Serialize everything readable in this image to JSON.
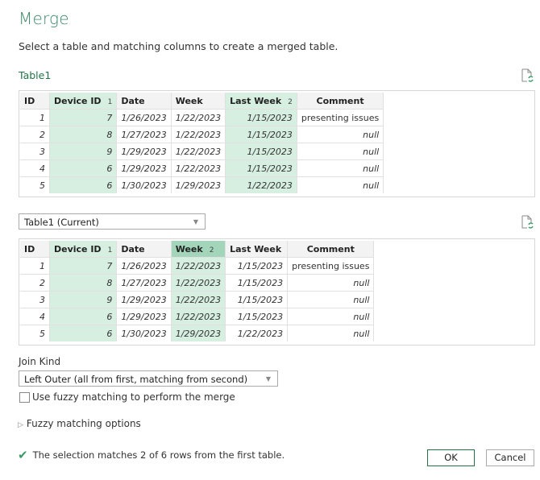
{
  "dialog": {
    "title": "Merge",
    "subtitle": "Select a table and matching columns to create a merged table."
  },
  "table1": {
    "label": "Table1",
    "refresh_icon": "refresh-preview-icon",
    "columns": [
      {
        "name": "ID",
        "selected": false,
        "order": ""
      },
      {
        "name": "Device ID",
        "selected": true,
        "order": "1"
      },
      {
        "name": "Date",
        "selected": false,
        "order": ""
      },
      {
        "name": "Week",
        "selected": false,
        "order": ""
      },
      {
        "name": "Last Week",
        "selected": true,
        "order": "2"
      },
      {
        "name": "Comment",
        "selected": false,
        "order": ""
      }
    ],
    "rows": [
      [
        "1",
        "7",
        "1/26/2023",
        "1/22/2023",
        "1/15/2023",
        "presenting issues"
      ],
      [
        "2",
        "8",
        "1/27/2023",
        "1/22/2023",
        "1/15/2023",
        "null"
      ],
      [
        "3",
        "9",
        "1/29/2023",
        "1/22/2023",
        "1/15/2023",
        "null"
      ],
      [
        "4",
        "6",
        "1/29/2023",
        "1/22/2023",
        "1/15/2023",
        "null"
      ],
      [
        "5",
        "6",
        "1/30/2023",
        "1/29/2023",
        "1/22/2023",
        "null"
      ]
    ]
  },
  "table2": {
    "selected_table": "Table1 (Current)",
    "refresh_icon": "refresh-preview-icon",
    "columns": [
      {
        "name": "ID",
        "selected": false,
        "order": ""
      },
      {
        "name": "Device ID",
        "selected": true,
        "order": "1"
      },
      {
        "name": "Date",
        "selected": false,
        "order": ""
      },
      {
        "name": "Week",
        "selected": true,
        "order": "2"
      },
      {
        "name": "Last Week",
        "selected": false,
        "order": ""
      },
      {
        "name": "Comment",
        "selected": false,
        "order": ""
      }
    ],
    "rows": [
      [
        "1",
        "7",
        "1/26/2023",
        "1/22/2023",
        "1/15/2023",
        "presenting issues"
      ],
      [
        "2",
        "8",
        "1/27/2023",
        "1/22/2023",
        "1/15/2023",
        "null"
      ],
      [
        "3",
        "9",
        "1/29/2023",
        "1/22/2023",
        "1/15/2023",
        "null"
      ],
      [
        "4",
        "6",
        "1/29/2023",
        "1/22/2023",
        "1/15/2023",
        "null"
      ],
      [
        "5",
        "6",
        "1/30/2023",
        "1/29/2023",
        "1/22/2023",
        "null"
      ]
    ]
  },
  "join": {
    "label": "Join Kind",
    "selected": "Left Outer (all from first, matching from second)",
    "fuzzy_checkbox_label": "Use fuzzy matching to perform the merge",
    "fuzzy_checked": false,
    "fuzzy_options_label": "Fuzzy matching options"
  },
  "status": {
    "icon": "check-icon",
    "text": "The selection matches 2 of 6 rows from the first table."
  },
  "buttons": {
    "ok": "OK",
    "cancel": "Cancel"
  },
  "colors": {
    "accent": "#217346",
    "selected_column": "#d6efe1",
    "active_column_header": "#a3d5bb"
  }
}
